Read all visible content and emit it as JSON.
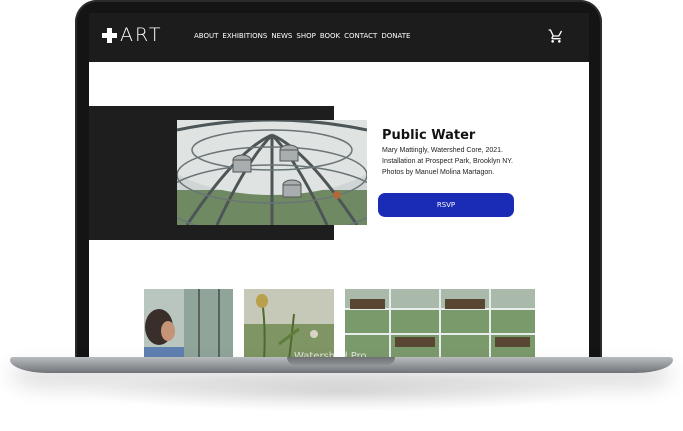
{
  "nav": {
    "logo_text": "ART",
    "items": [
      "ABOUT",
      "EXHIBITIONS",
      "NEWS",
      "SHOP",
      "BOOK",
      "CONTACT",
      "DONATE"
    ],
    "cart_icon": "cart-icon"
  },
  "hero": {
    "title": "Public Water",
    "caption_lines": [
      "Mary Mattingly, Watershed Core, 2021.",
      "Installation at Prospect Park, Brooklyn NY.",
      "Photos by Manuel Molina Martagon."
    ],
    "rsvp_label": "RSVP"
  },
  "gallery": {
    "overlay_text": "Watershed Pro"
  },
  "colors": {
    "nav_bg": "#1c1c1c",
    "hero_block": "#1e1e1e",
    "button": "#1a2cb5"
  }
}
